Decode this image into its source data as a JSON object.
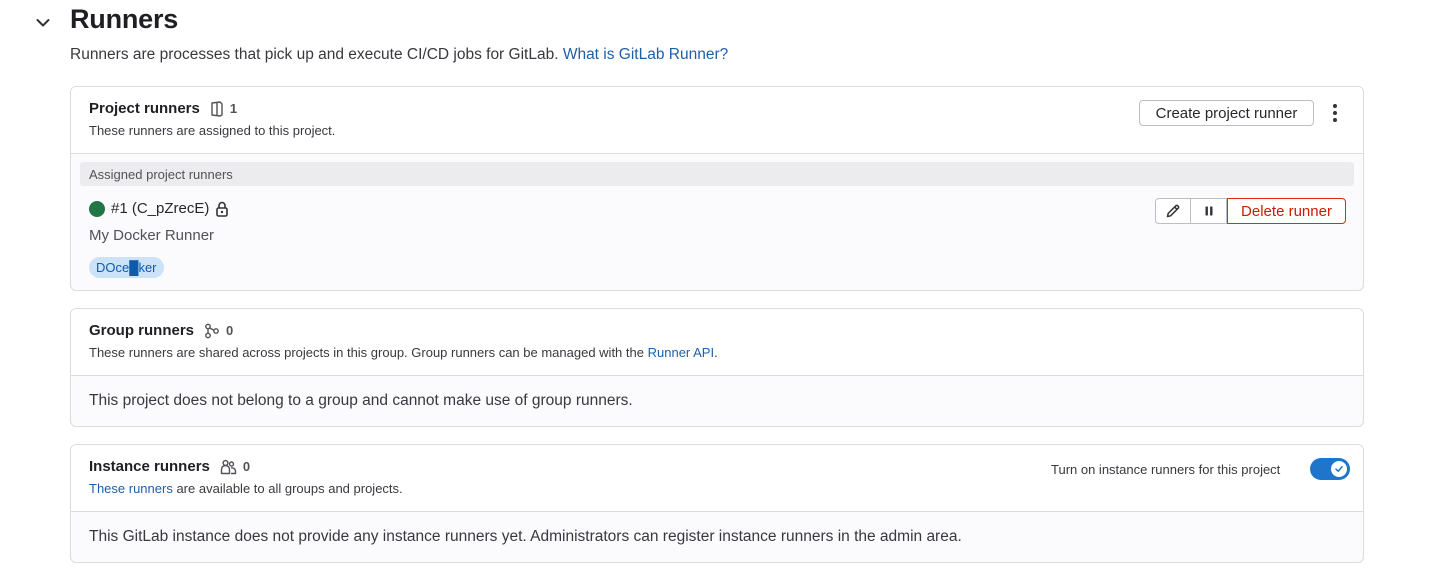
{
  "section": {
    "title": "Runners",
    "description": "Runners are processes that pick up and execute CI/CD jobs for GitLab.",
    "help_link": "What is GitLab Runner?"
  },
  "project_runners": {
    "title": "Project runners",
    "count": "1",
    "description": "These runners are assigned to this project.",
    "create_button": "Create project runner",
    "subheader": "Assigned project runners",
    "runner": {
      "name": "#1 (C_pZrecE)",
      "status_color": "#217645",
      "description": "My Docker Runner",
      "tag": "DOce█ker",
      "delete_button": "Delete runner"
    }
  },
  "group_runners": {
    "title": "Group runners",
    "count": "0",
    "description_prefix": "These runners are shared across projects in this group. Group runners can be managed with the",
    "description_link": "Runner API",
    "description_suffix": ".",
    "body": "This project does not belong to a group and cannot make use of group runners."
  },
  "instance_runners": {
    "title": "Instance runners",
    "count": "0",
    "description_link": "These runners",
    "description_suffix": "are available to all groups and projects.",
    "toggle_label": "Turn on instance runners for this project",
    "toggle_on": true,
    "body": "This GitLab instance does not provide any instance runners yet. Administrators can register instance runners in the admin area."
  },
  "colors": {
    "link": "#1f5fa8",
    "danger": "#dd2b0e",
    "toggle": "#1f75cb",
    "tag_bg": "#cbe2f9"
  }
}
